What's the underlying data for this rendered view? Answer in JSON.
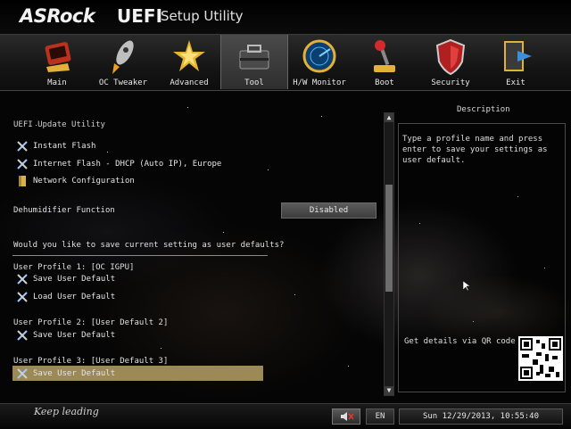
{
  "header": {
    "brand": "ASRock",
    "product": "UEFI",
    "subtitle": "Setup Utility"
  },
  "nav": {
    "active_tab": "Tool",
    "tabs": [
      {
        "label": "Main",
        "icon": "main-icon"
      },
      {
        "label": "OC Tweaker",
        "icon": "rocket-icon"
      },
      {
        "label": "Advanced",
        "icon": "star-icon"
      },
      {
        "label": "Tool",
        "icon": "toolbox-icon"
      },
      {
        "label": "H/W Monitor",
        "icon": "radar-icon"
      },
      {
        "label": "Boot",
        "icon": "joystick-icon"
      },
      {
        "label": "Security",
        "icon": "shield-icon"
      },
      {
        "label": "Exit",
        "icon": "exit-icon"
      }
    ]
  },
  "content": {
    "section_title": "UEFI Update Utility",
    "utilities": [
      {
        "label": "Instant Flash",
        "icon": "tool-icon"
      },
      {
        "label": "Internet Flash - DHCP (Auto IP), Europe",
        "icon": "tool-icon"
      },
      {
        "label": "Network Configuration",
        "icon": "folder-icon"
      }
    ],
    "dehumidifier": {
      "label": "Dehumidifier Function",
      "value": "Disabled"
    },
    "question": "Would you like to save current setting as user defaults?",
    "profiles": [
      {
        "title": "User Profile 1: [OC IGPU]",
        "actions": [
          "Save User Default",
          "Load User Default"
        ]
      },
      {
        "title": "User Profile 2: [User Default 2]",
        "actions": [
          "Save User Default"
        ]
      },
      {
        "title": "User Profile 3: [User Default 3]",
        "actions": [
          "Save User Default"
        ]
      }
    ],
    "selected_item": "Save User Default"
  },
  "description": {
    "title": "Description",
    "text": "Type a profile name and press enter to save your settings as user default.",
    "qr_label": "Get details via QR code"
  },
  "footer": {
    "slogan": "Keep leading",
    "mute_icon": "speaker-mute-icon",
    "language": "EN",
    "datetime": "Sun 12/29/2013, 10:55:40"
  },
  "colors": {
    "highlight": "#9b8a55",
    "background": "#070707",
    "text": "#e0e0e0"
  }
}
